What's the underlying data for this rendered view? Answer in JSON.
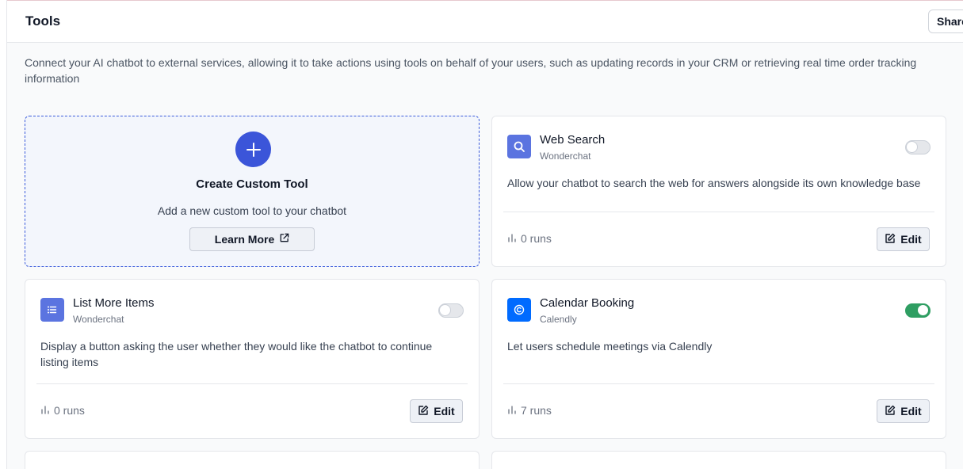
{
  "header": {
    "title": "Tools",
    "share_label": "Share"
  },
  "intro": "Connect your AI chatbot to external services, allowing it to take actions using tools on behalf of your users, such as updating records in your CRM or retrieving real time order tracking information",
  "create_tool": {
    "title": "Create Custom Tool",
    "subtitle": "Add a new custom tool to your chatbot",
    "learn_more_label": "Learn More"
  },
  "tools": [
    {
      "name": "Web Search",
      "vendor": "Wonderchat",
      "description": "Allow your chatbot to search the web for answers alongside its own knowledge base",
      "runs": "0 runs",
      "enabled": false,
      "icon": "search-icon",
      "edit_label": "Edit"
    },
    {
      "name": "List More Items",
      "vendor": "Wonderchat",
      "description": "Display a button asking the user whether they would like the chatbot to continue listing items",
      "runs": "0 runs",
      "enabled": false,
      "icon": "list-icon",
      "edit_label": "Edit"
    },
    {
      "name": "Calendar Booking",
      "vendor": "Calendly",
      "description": "Let users schedule meetings via Calendly",
      "runs": "7 runs",
      "enabled": true,
      "icon": "calendly-icon",
      "edit_label": "Edit"
    }
  ],
  "colors": {
    "accent": "#3b55d9",
    "toggle_on": "#2f9e62",
    "tool_icon_bg": "#5b74e0",
    "calendly_bg": "#006bff"
  }
}
